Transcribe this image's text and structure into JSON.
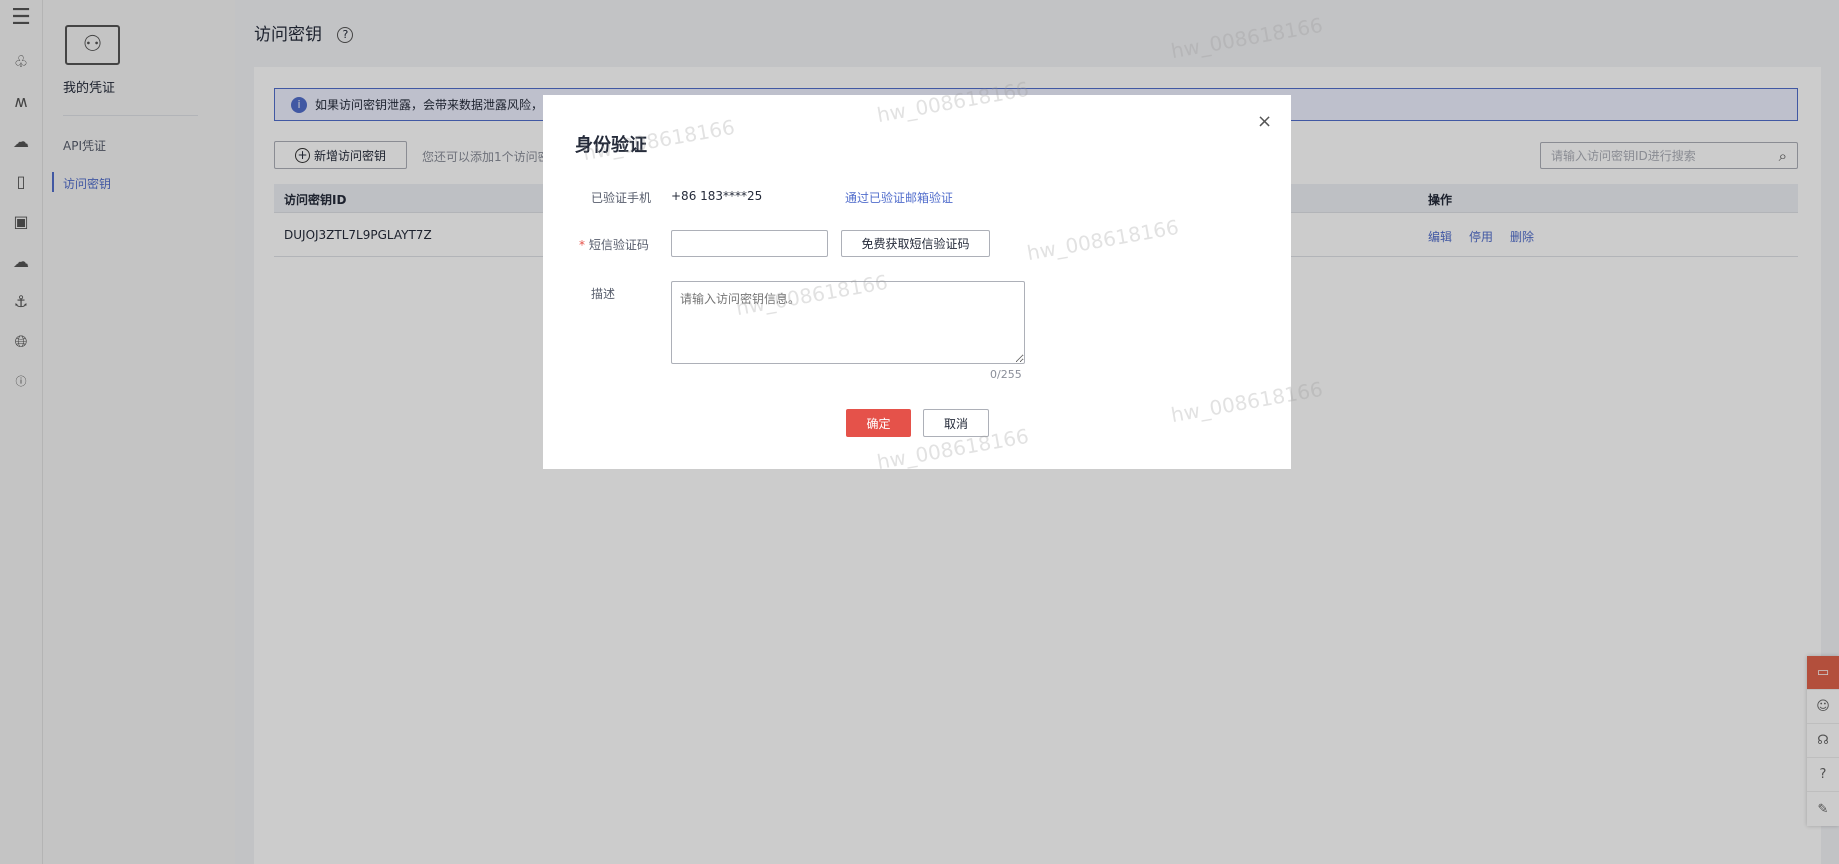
{
  "rail": {
    "icons": [
      "menu-icon",
      "cluster-icon",
      "wave-icon",
      "cloud-drive-icon",
      "phone-icon",
      "phone-cloud-icon",
      "cloud-check-icon",
      "anchor-icon",
      "globe-icon",
      "ip-icon"
    ]
  },
  "sidebar": {
    "title": "我的凭证",
    "items": [
      {
        "label": "API凭证"
      },
      {
        "label": "访问密钥",
        "active": true
      }
    ]
  },
  "page": {
    "title": "访问密钥",
    "banner": "如果访问密钥泄露，会带来数据泄露风险，",
    "add_button": "新增访问密钥",
    "add_hint": "您还可以添加1个访问密",
    "search_placeholder": "请输入访问密钥ID进行搜索",
    "table": {
      "headers": {
        "id": "访问密钥ID",
        "ops": "操作"
      },
      "rows": [
        {
          "id": "DUJOJ3ZTL7L9PGLAYT7Z",
          "ops": [
            "编辑",
            "停用",
            "删除"
          ]
        }
      ]
    }
  },
  "modal": {
    "title": "身份验证",
    "phone_label": "已验证手机",
    "phone_value": "+86 183****25",
    "email_link": "通过已验证邮箱验证",
    "sms_label": "短信验证码",
    "sms_value": "",
    "sms_button": "免费获取短信验证码",
    "desc_label": "描述",
    "desc_placeholder": "请输入访问密钥信息。",
    "desc_counter": "0/255",
    "confirm": "确定",
    "cancel": "取消"
  },
  "watermark": "hw_008618166",
  "colors": {
    "accent": "#526ecc",
    "danger": "#e5524a",
    "float_active": "#e0634b"
  }
}
